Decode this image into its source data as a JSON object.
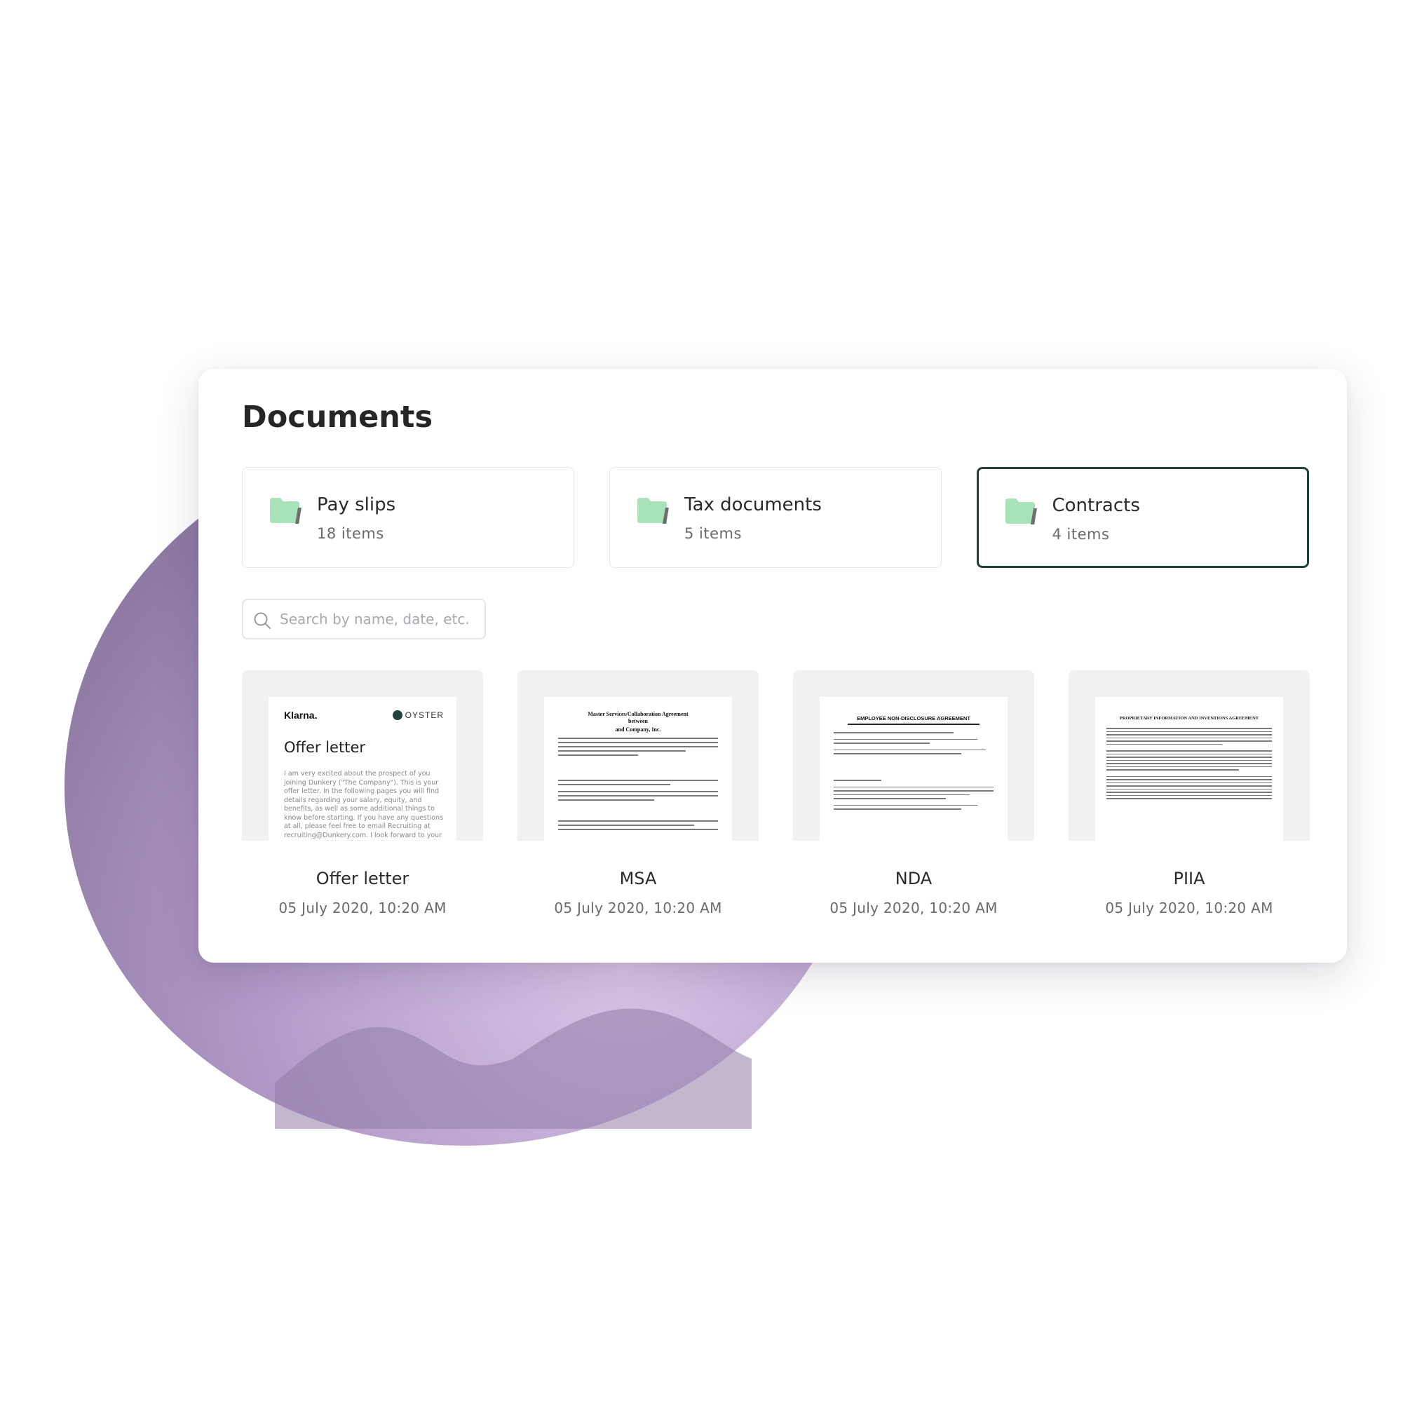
{
  "panel": {
    "title": "Documents"
  },
  "folders": [
    {
      "name": "Pay slips",
      "count": "18 items",
      "selected": false
    },
    {
      "name": "Tax documents",
      "count": "5 items",
      "selected": false
    },
    {
      "name": "Contracts",
      "count": "4 items",
      "selected": true
    }
  ],
  "search": {
    "placeholder": "Search by name, date, etc.",
    "value": ""
  },
  "documents": [
    {
      "name": "Offer letter",
      "date": "05 July 2020, 10:20 AM"
    },
    {
      "name": "MSA",
      "date": "05 July 2020, 10:20 AM"
    },
    {
      "name": "NDA",
      "date": "05 July 2020, 10:20 AM"
    },
    {
      "name": "PIIA",
      "date": "05 July 2020, 10:20 AM"
    }
  ],
  "previews": {
    "offer_letter": {
      "brand": "Klarna.",
      "partner": "OYSTER",
      "title": "Offer letter",
      "body": "I am very excited about the prospect of you joining Dunkery (\"The Company\"). This is your offer letter. In the following pages you will find details regarding your salary, equity, and benefits, as well as some additional things to know before starting. If you have any questions at all, please feel free to email Recruiting at recruiting@Dunkery.com. I look forward to your response and (hopefully) working together."
    },
    "msa": {
      "title": "Master Services/Collaboration Agreement",
      "subtitle": "between",
      "party": "and Company, Inc."
    },
    "nda": {
      "title": "EMPLOYEE NON-DISCLOSURE AGREEMENT"
    },
    "piia": {
      "title": "PROPRIETARY INFORMATION AND INVENTIONS AGREEMENT"
    }
  },
  "colors": {
    "accent": "#24403a",
    "folder_icon": "#a8e2b8",
    "background_blob": "#b9a2cc"
  },
  "icons": {
    "folder": "folder-icon",
    "search": "search-icon"
  }
}
